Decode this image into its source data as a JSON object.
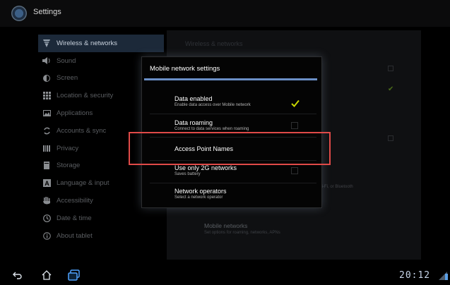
{
  "app": {
    "title": "Settings"
  },
  "sidebar": {
    "items": [
      {
        "label": "Wireless & networks",
        "icon": "wifi-icon"
      },
      {
        "label": "Sound",
        "icon": "speaker-icon"
      },
      {
        "label": "Screen",
        "icon": "contrast-icon"
      },
      {
        "label": "Location & security",
        "icon": "grid-icon"
      },
      {
        "label": "Applications",
        "icon": "image-icon"
      },
      {
        "label": "Accounts & sync",
        "icon": "sync-icon"
      },
      {
        "label": "Privacy",
        "icon": "bars-icon"
      },
      {
        "label": "Storage",
        "icon": "storage-icon"
      },
      {
        "label": "Language & input",
        "icon": "language-icon"
      },
      {
        "label": "Accessibility",
        "icon": "hand-icon"
      },
      {
        "label": "Date & time",
        "icon": "clock-icon"
      },
      {
        "label": "About tablet",
        "icon": "info-icon"
      }
    ]
  },
  "pane": {
    "header": "Wireless & networks",
    "wifi_bt_subtext": "Wi-Fi, or Bluetooth",
    "mobile_networks": {
      "title": "Mobile networks",
      "subtitle": "Set options for roaming, networks, APNs"
    }
  },
  "dialog": {
    "title": "Mobile network settings",
    "rows": [
      {
        "title": "Data enabled",
        "subtitle": "Enable data access over Mobile network",
        "checked": true
      },
      {
        "title": "Data roaming",
        "subtitle": "Connect to data services when roaming",
        "checked": false
      },
      {
        "title": "Access Point Names",
        "subtitle": ""
      },
      {
        "title": "Use only 2G networks",
        "subtitle": "Saves battery",
        "checked": false
      },
      {
        "title": "Network operators",
        "subtitle": "Select a network operator"
      }
    ]
  },
  "statusbar": {
    "time": "20:12"
  },
  "colors": {
    "accent": "#6b8fc6",
    "check": "#c8d600",
    "highlight": "#e04a48"
  }
}
